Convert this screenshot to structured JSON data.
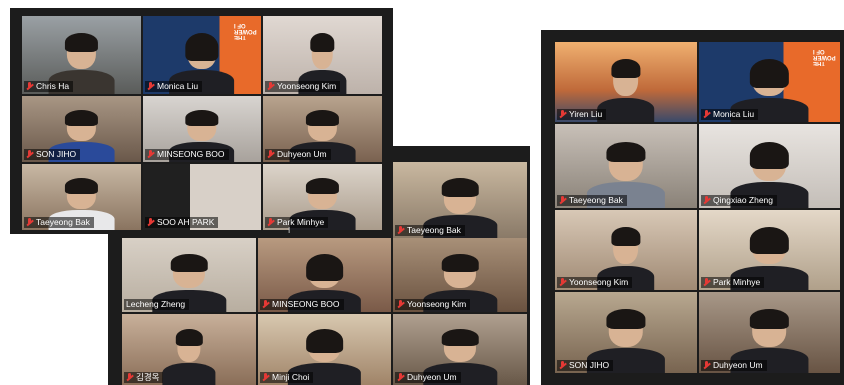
{
  "colors": {
    "active_speaker": "#c6db5e",
    "muted": "#e53935",
    "window_bg": "#1c1c1c"
  },
  "window_a": {
    "tiles": [
      {
        "name": "Chris Ha",
        "muted": true,
        "active": true
      },
      {
        "name": "Monica Liu",
        "muted": true
      },
      {
        "name": "Yoonseong Kim",
        "muted": true
      },
      {
        "name": "SON JIHO",
        "muted": true
      },
      {
        "name": "MINSEONG BOO",
        "muted": true
      },
      {
        "name": "Duhyeon Um",
        "muted": true
      },
      {
        "name": "Taeyeong Bak",
        "muted": true
      },
      {
        "name": "SOO AH PARK",
        "muted": true
      },
      {
        "name": "Park Minhye",
        "muted": true
      }
    ]
  },
  "window_b": {
    "tiles": [
      {
        "name": "Taeyeong Bak",
        "muted": true
      },
      {
        "name": "Lecheng Zheng",
        "muted": false,
        "active": true
      },
      {
        "name": "MINSEONG BOO",
        "muted": true
      },
      {
        "name": "Yoonseong Kim",
        "muted": true
      },
      {
        "name": "김경옥",
        "muted": true
      },
      {
        "name": "Minji Choi",
        "muted": true
      },
      {
        "name": "Duhyeon Um",
        "muted": true
      }
    ]
  },
  "window_c": {
    "tiles": [
      {
        "name": "Yiren Liu",
        "muted": true
      },
      {
        "name": "Monica Liu",
        "muted": true
      },
      {
        "name": "Taeyeong Bak",
        "muted": true
      },
      {
        "name": "Qingxiao Zheng",
        "muted": true,
        "active": true
      },
      {
        "name": "Yoonseong Kim",
        "muted": true
      },
      {
        "name": "Park Minhye",
        "muted": true
      },
      {
        "name": "SON JIHO",
        "muted": true
      },
      {
        "name": "Duhyeon Um",
        "muted": true
      }
    ]
  }
}
